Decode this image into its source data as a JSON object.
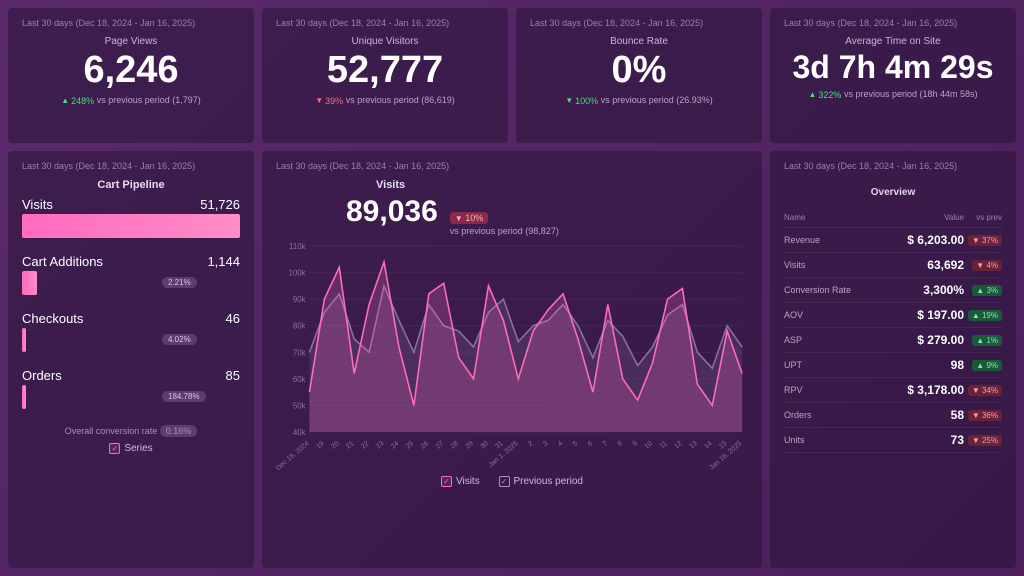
{
  "date_range": "Last 30 days (Dec 18, 2024 - Jan 16, 2025)",
  "kpis": [
    {
      "title": "Page Views",
      "value": "6,246",
      "dir": "up",
      "pct": "248%",
      "note": "vs previous period (1,797)"
    },
    {
      "title": "Unique Visitors",
      "value": "52,777",
      "dir": "down",
      "pct": "39%",
      "note": "vs previous period (86,619)"
    },
    {
      "title": "Bounce Rate",
      "value": "0%",
      "dir": "down_good",
      "pct": "100%",
      "note": "vs previous period (26.93%)"
    },
    {
      "title": "Average Time on Site",
      "value": "3d 7h 4m 29s",
      "dir": "up",
      "pct": "322%",
      "note": "vs previous period (18h 44m 58s)"
    }
  ],
  "funnel": {
    "title": "Cart Pipeline",
    "stages": [
      {
        "label": "Visits",
        "value": "51,726",
        "width": 100,
        "pct": null
      },
      {
        "label": "Cart Additions",
        "value": "1,144",
        "width": 7,
        "pct": "2.21%"
      },
      {
        "label": "Checkouts",
        "value": "46",
        "width": 2,
        "pct": "4.02%"
      },
      {
        "label": "Orders",
        "value": "85",
        "width": 2,
        "pct": "184.78%"
      }
    ],
    "footer_label": "Overall conversion rate",
    "footer_value": "0.16%",
    "legend": "Series"
  },
  "visits_chart": {
    "title": "Visits",
    "value": "89,036",
    "change_pct": "10%",
    "change_dir": "down",
    "note": "vs previous period (98,827)",
    "legend": [
      "Visits",
      "Previous period"
    ]
  },
  "chart_data": {
    "type": "area",
    "ylabel": "",
    "ylim": [
      40000,
      110000
    ],
    "y_ticks": [
      "110k",
      "100k",
      "90k",
      "80k",
      "70k",
      "60k",
      "50k",
      "40k"
    ],
    "x": [
      "Dec 18, 2024",
      "19",
      "20",
      "21",
      "22",
      "23",
      "24",
      "25",
      "26",
      "27",
      "28",
      "29",
      "30",
      "31",
      "Jan 1, 2025",
      "2",
      "3",
      "4",
      "5",
      "6",
      "7",
      "8",
      "9",
      "10",
      "11",
      "12",
      "13",
      "14",
      "15",
      "Jan 16, 2025"
    ],
    "series": [
      {
        "name": "Visits",
        "color": "#ff6bbd",
        "values": [
          55000,
          90000,
          102000,
          62000,
          88000,
          104000,
          72000,
          50000,
          92000,
          96000,
          68000,
          60000,
          95000,
          82000,
          60000,
          78000,
          86000,
          92000,
          75000,
          55000,
          88000,
          60000,
          52000,
          66000,
          90000,
          94000,
          58000,
          50000,
          78000,
          62000
        ]
      },
      {
        "name": "Previous period",
        "color": "#8a70a0",
        "values": [
          70000,
          85000,
          92000,
          75000,
          70000,
          95000,
          82000,
          70000,
          88000,
          80000,
          78000,
          72000,
          85000,
          90000,
          74000,
          80000,
          82000,
          88000,
          80000,
          68000,
          82000,
          76000,
          65000,
          72000,
          84000,
          88000,
          70000,
          64000,
          80000,
          72000
        ]
      }
    ]
  },
  "overview": {
    "title": "Overview",
    "headers": {
      "name": "Name",
      "value": "Value",
      "prev": "vs prev"
    },
    "rows": [
      {
        "name": "Revenue",
        "value": "$ 6,203.00",
        "dir": "down",
        "pct": "37%"
      },
      {
        "name": "Visits",
        "value": "63,692",
        "dir": "down",
        "pct": "4%"
      },
      {
        "name": "Conversion Rate",
        "value": "3,300%",
        "dir": "up",
        "pct": "3%"
      },
      {
        "name": "AOV",
        "value": "$ 197.00",
        "dir": "up",
        "pct": "19%"
      },
      {
        "name": "ASP",
        "value": "$ 279.00",
        "dir": "up",
        "pct": "1%"
      },
      {
        "name": "UPT",
        "value": "98",
        "dir": "up",
        "pct": "9%"
      },
      {
        "name": "RPV",
        "value": "$ 3,178.00",
        "dir": "down",
        "pct": "34%"
      },
      {
        "name": "Orders",
        "value": "58",
        "dir": "down",
        "pct": "36%"
      },
      {
        "name": "Units",
        "value": "73",
        "dir": "down",
        "pct": "25%"
      }
    ]
  }
}
